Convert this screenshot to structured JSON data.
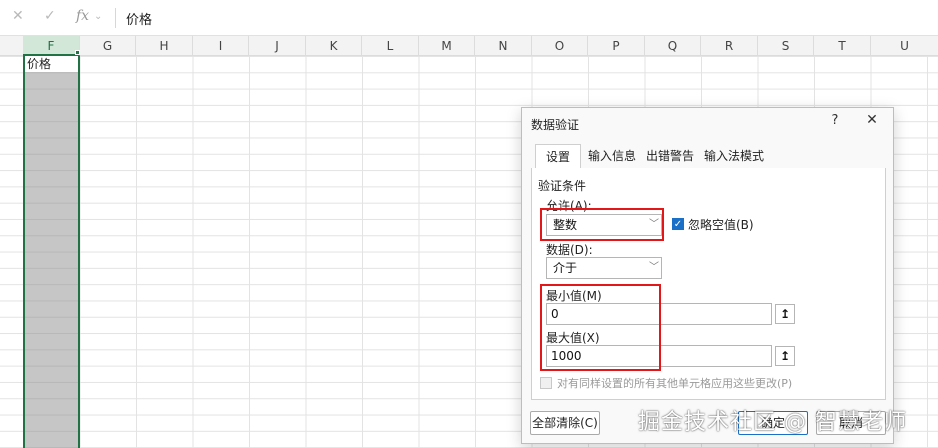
{
  "formula_bar": {
    "cancel_icon": "✕",
    "confirm_icon": "✓",
    "fx_label": "fx",
    "dropdown_icon": "⌄",
    "content": "价格"
  },
  "columns": [
    "F",
    "G",
    "H",
    "I",
    "J",
    "K",
    "L",
    "M",
    "N",
    "O",
    "P",
    "Q",
    "R",
    "S",
    "T",
    "U"
  ],
  "selected_column": "F",
  "cells": {
    "F1": "价格"
  },
  "dialog": {
    "title": "数据验证",
    "help": "?",
    "close": "✕",
    "tabs": [
      "设置",
      "输入信息",
      "出错警告",
      "输入法模式"
    ],
    "active_tab": "设置",
    "section_label": "验证条件",
    "allow_label": "允许(A):",
    "allow_value": "整数",
    "ignore_blank_label": "忽略空值(B)",
    "ignore_blank_checked": true,
    "data_label": "数据(D):",
    "data_value": "介于",
    "min_label": "最小值(M)",
    "min_value": "0",
    "max_label": "最大值(X)",
    "max_value": "1000",
    "apply_all_label": "对有同样设置的所有其他单元格应用这些更改(P)",
    "clear_all_label": "全部清除(C)",
    "ok_label": "确定",
    "cancel_label": "取消"
  },
  "watermark": "掘金技术社区 @ 智慧老师",
  "colors": {
    "accent": "#217346",
    "highlight": "#e21818",
    "check": "#1a6fc6"
  }
}
